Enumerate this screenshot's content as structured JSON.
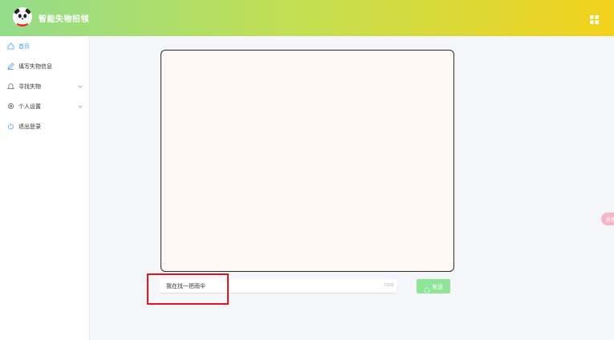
{
  "header": {
    "app_title": "智能失物招领",
    "menu_icon": "grid-icon"
  },
  "sidebar": {
    "items": [
      {
        "label": "首页",
        "icon": "home-icon",
        "active": true
      },
      {
        "label": "填写失物信息",
        "icon": "edit-icon"
      },
      {
        "label": "寻找失物",
        "icon": "search-bell-icon",
        "expandable": true
      },
      {
        "label": "个人设置",
        "icon": "settings-icon",
        "expandable": true
      },
      {
        "label": "退出登录",
        "icon": "power-icon"
      }
    ]
  },
  "main": {
    "input": {
      "value": "我在找一把雨伞",
      "count": "7/200"
    },
    "send_button": {
      "label": "发送",
      "icon": "send-icon"
    }
  },
  "float_tab": {
    "label": "反馈"
  },
  "colors": {
    "header_start": "#93dc8a",
    "header_end": "#f3d21c",
    "accent": "#409eff",
    "send_button": "#8ee597",
    "highlight": "#e3141c",
    "canvas_bg": "#fff7f3"
  }
}
